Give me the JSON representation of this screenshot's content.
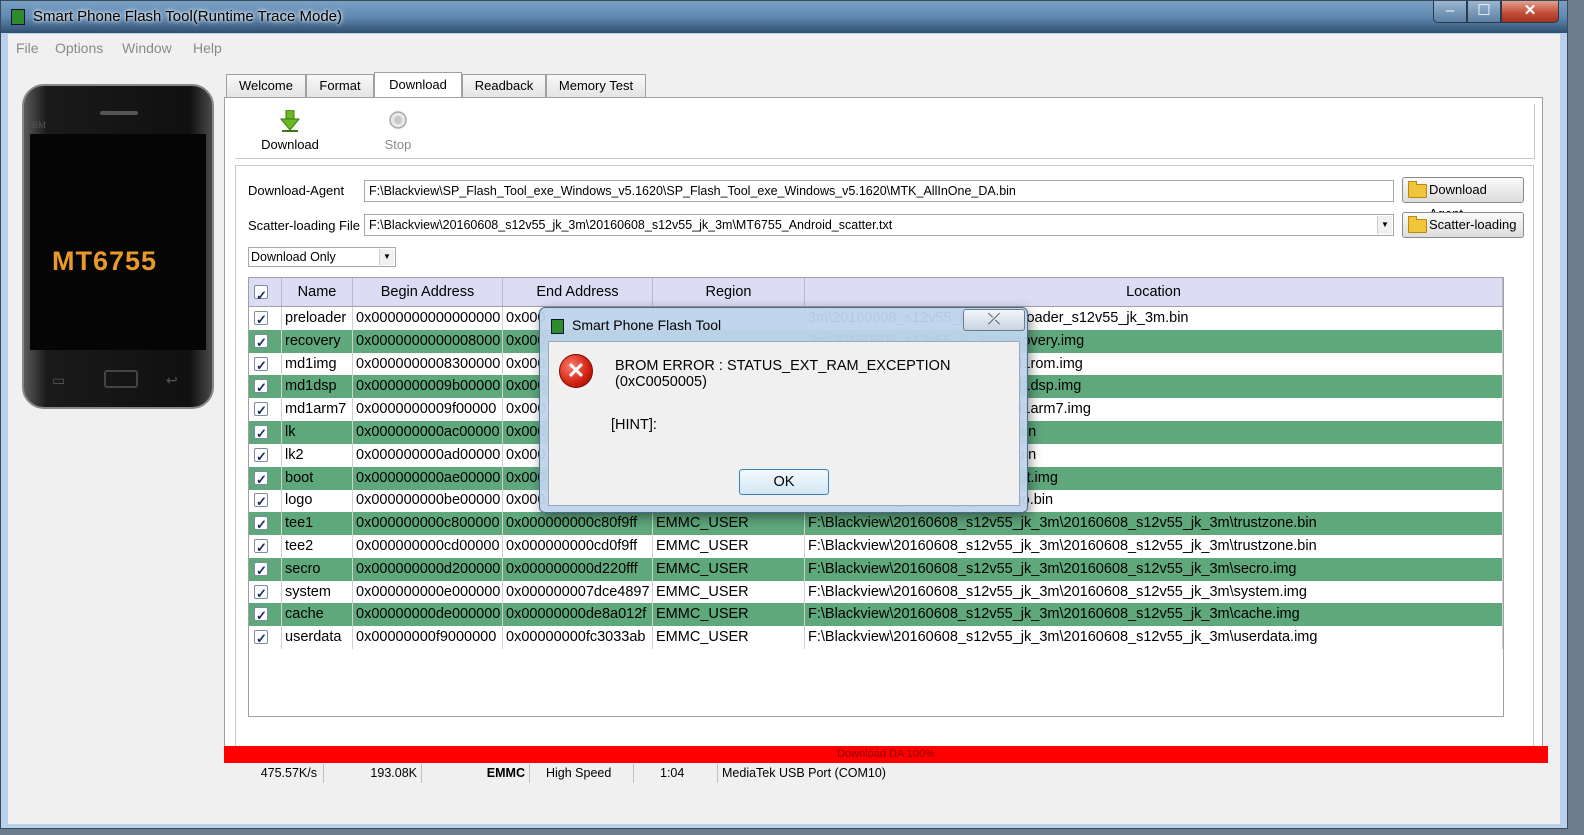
{
  "window": {
    "title": "Smart Phone Flash Tool(Runtime Trace Mode)",
    "min": "–",
    "max": "☐",
    "close": "✕"
  },
  "menu": [
    "File",
    "Options",
    "Window",
    "Help"
  ],
  "phone": {
    "brand": "BM",
    "chip": "MT6755"
  },
  "tabs": [
    "Welcome",
    "Format",
    "Download",
    "Readback",
    "Memory Test"
  ],
  "active_tab": "Download",
  "toolbar": {
    "download": "Download",
    "stop": "Stop"
  },
  "form": {
    "da_label": "Download-Agent",
    "da_value": "F:\\Blackview\\SP_Flash_Tool_exe_Windows_v5.1620\\SP_Flash_Tool_exe_Windows_v5.1620\\MTK_AllInOne_DA.bin",
    "da_button": "Download Agent",
    "scatter_label": "Scatter-loading File",
    "scatter_value": "F:\\Blackview\\20160608_s12v55_jk_3m\\20160608_s12v55_jk_3m\\MT6755_Android_scatter.txt",
    "scatter_button": "Scatter-loading",
    "mode": "Download Only"
  },
  "table": {
    "headers": [
      "Name",
      "Begin Address",
      "End Address",
      "Region",
      "Location"
    ],
    "rows": [
      {
        "name": "preloader",
        "begin": "0x0000000000000000",
        "end": "0x000",
        "region": "",
        "location": "3m\\20160608_s12v55_jk_3m\\preloader_s12v55_jk_3m.bin"
      },
      {
        "name": "recovery",
        "begin": "0x0000000000008000",
        "end": "0x000",
        "region": "",
        "location": "3m\\20160608_s12v55_jk_3m\\recovery.img"
      },
      {
        "name": "md1img",
        "begin": "0x0000000008300000",
        "end": "0x000",
        "region": "",
        "location": "3m\\20160608_s12v55_jk_3m\\md1rom.img"
      },
      {
        "name": "md1dsp",
        "begin": "0x0000000009b00000",
        "end": "0x000",
        "region": "",
        "location": "3m\\20160608_s12v55_jk_3m\\md1dsp.img"
      },
      {
        "name": "md1arm7",
        "begin": "0x0000000009f00000",
        "end": "0x000",
        "region": "",
        "location": "3m\\20160608_s12v55_jk_3m\\md1arm7.img"
      },
      {
        "name": "lk",
        "begin": "0x000000000ac00000",
        "end": "0x000",
        "region": "",
        "location": "3m\\20160608_s12v55_jk_3m\\lk.bin"
      },
      {
        "name": "lk2",
        "begin": "0x000000000ad00000",
        "end": "0x000",
        "region": "",
        "location": "3m\\20160608_s12v55_jk_3m\\lk.bin"
      },
      {
        "name": "boot",
        "begin": "0x000000000ae00000",
        "end": "0x000",
        "region": "",
        "location": "3m\\20160608_s12v55_jk_3m\\boot.img"
      },
      {
        "name": "logo",
        "begin": "0x000000000be00000",
        "end": "0x000",
        "region": "",
        "location": "3m\\20160608_s12v55_jk_3m\\logo.bin"
      },
      {
        "name": "tee1",
        "begin": "0x000000000c800000",
        "end": "0x000000000c80f9ff",
        "region": "EMMC_USER",
        "location": "F:\\Blackview\\20160608_s12v55_jk_3m\\20160608_s12v55_jk_3m\\trustzone.bin"
      },
      {
        "name": "tee2",
        "begin": "0x000000000cd00000",
        "end": "0x000000000cd0f9ff",
        "region": "EMMC_USER",
        "location": "F:\\Blackview\\20160608_s12v55_jk_3m\\20160608_s12v55_jk_3m\\trustzone.bin"
      },
      {
        "name": "secro",
        "begin": "0x000000000d200000",
        "end": "0x000000000d220fff",
        "region": "EMMC_USER",
        "location": "F:\\Blackview\\20160608_s12v55_jk_3m\\20160608_s12v55_jk_3m\\secro.img"
      },
      {
        "name": "system",
        "begin": "0x000000000e000000",
        "end": "0x000000007dce4897",
        "region": "EMMC_USER",
        "location": "F:\\Blackview\\20160608_s12v55_jk_3m\\20160608_s12v55_jk_3m\\system.img"
      },
      {
        "name": "cache",
        "begin": "0x00000000de000000",
        "end": "0x00000000de8a012f",
        "region": "EMMC_USER",
        "location": "F:\\Blackview\\20160608_s12v55_jk_3m\\20160608_s12v55_jk_3m\\cache.img"
      },
      {
        "name": "userdata",
        "begin": "0x00000000f9000000",
        "end": "0x00000000fc3033ab",
        "region": "EMMC_USER",
        "location": "F:\\Blackview\\20160608_s12v55_jk_3m\\20160608_s12v55_jk_3m\\userdata.img"
      }
    ]
  },
  "progress": {
    "label": "Download DA 100%",
    "percent": 100,
    "color": "#ff0000"
  },
  "status": {
    "speed": "475.57K/s",
    "size": "193.08K",
    "storage": "EMMC",
    "usb_speed": "High Speed",
    "time": "1:04",
    "port": "MediaTek USB Port (COM10)"
  },
  "dialog": {
    "title": "Smart Phone Flash Tool",
    "close": "⤫",
    "message": "BROM ERROR : STATUS_EXT_RAM_EXCEPTION (0xC0050005)",
    "hint": "[HINT]:",
    "ok": "OK",
    "icon": "error-icon"
  },
  "colors": {
    "row_alt": "#5fa87c",
    "header": "#dcdcf4",
    "titlebar": "#5f89b2"
  }
}
